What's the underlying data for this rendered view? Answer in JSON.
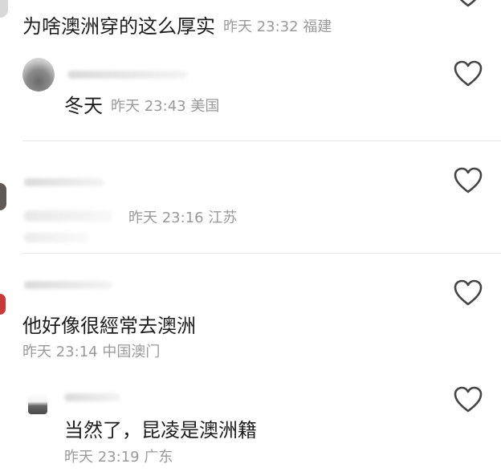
{
  "comments": [
    {
      "id": "c1",
      "text": "为啥澳洲穿的这么厚实",
      "time": "昨天 23:32",
      "location": "福建"
    },
    {
      "id": "c2",
      "text": "冬天",
      "time": "昨天 23:43",
      "location": "美国"
    },
    {
      "id": "c3",
      "text": "",
      "time": "昨天 23:16",
      "location": "江苏"
    },
    {
      "id": "c4",
      "text": "他好像很經常去澳洲",
      "time": "昨天 23:14",
      "location": "中国澳门"
    },
    {
      "id": "c5",
      "text": "当然了，昆凌是澳洲籍",
      "time": "昨天 23:19",
      "location": "广东"
    }
  ],
  "icons": {
    "like": "heart-outline-icon"
  },
  "colors": {
    "primary_text": "#1e1e1e",
    "meta_text": "#9a9a9a",
    "divider": "#e6e6e6",
    "icon_stroke": "#444444"
  }
}
